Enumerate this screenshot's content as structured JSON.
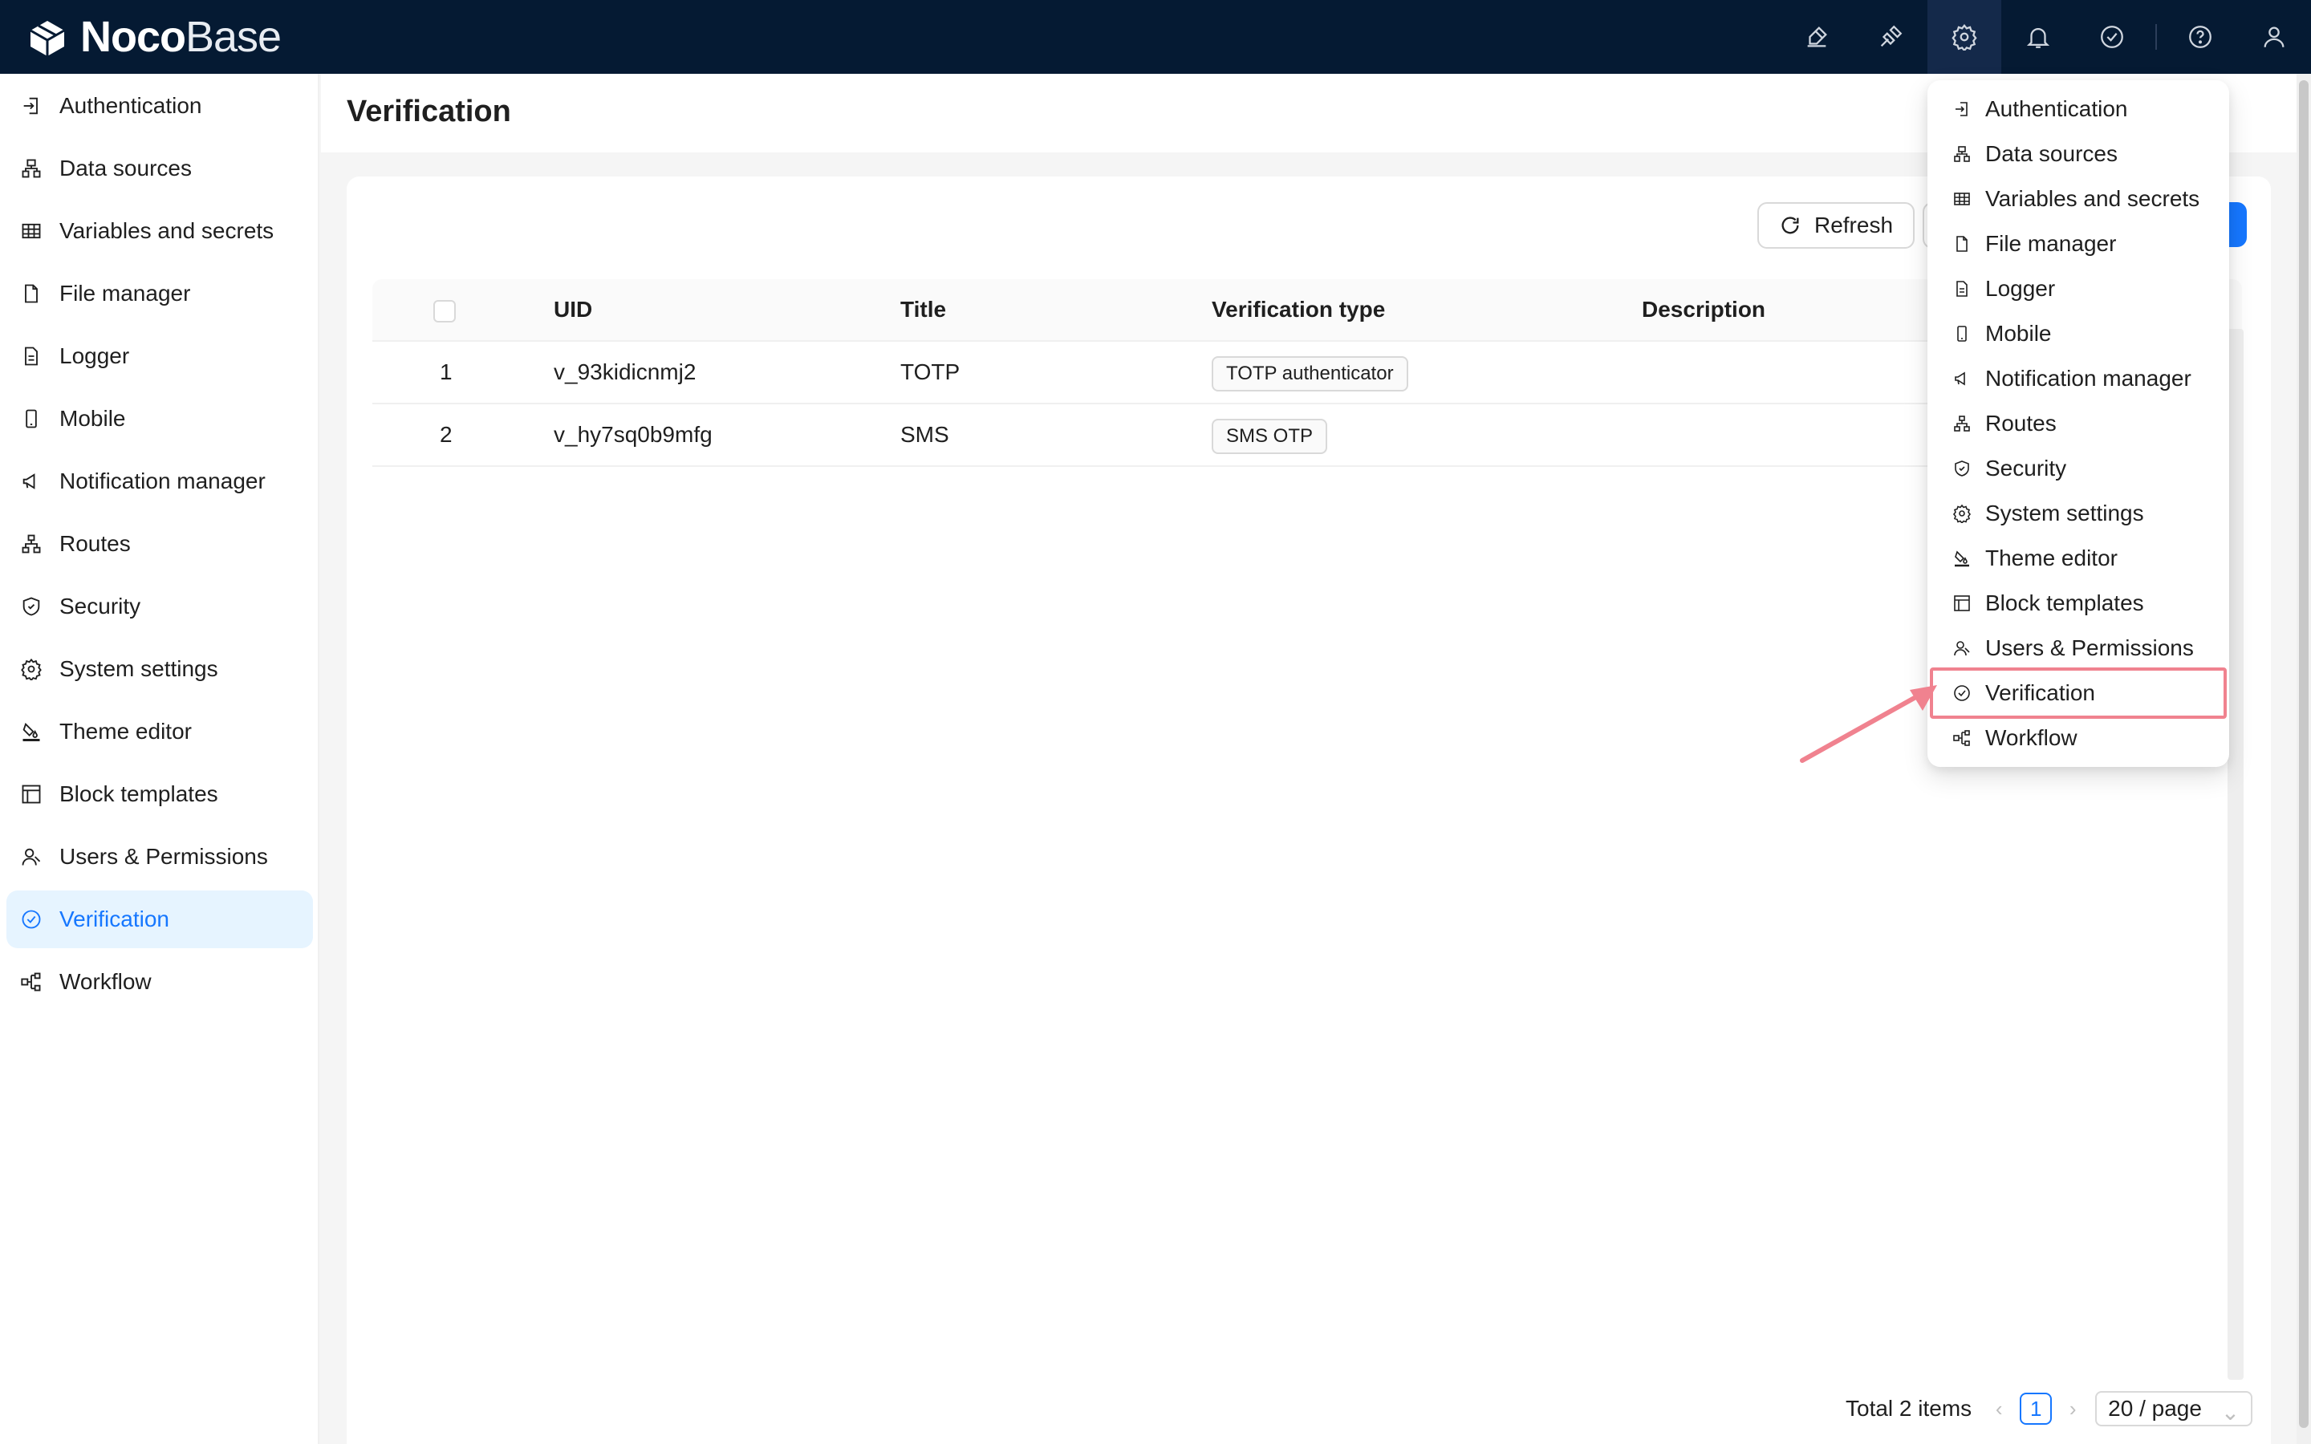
{
  "header": {
    "brand_bold": "Noco",
    "brand_light": "Base"
  },
  "sidebar": {
    "items": [
      {
        "label": "Authentication",
        "icon": "login-icon"
      },
      {
        "label": "Data sources",
        "icon": "database-icon"
      },
      {
        "label": "Variables and secrets",
        "icon": "table-icon"
      },
      {
        "label": "File manager",
        "icon": "file-icon"
      },
      {
        "label": "Logger",
        "icon": "file-text-icon"
      },
      {
        "label": "Mobile",
        "icon": "mobile-icon"
      },
      {
        "label": "Notification manager",
        "icon": "megaphone-icon"
      },
      {
        "label": "Routes",
        "icon": "sitemap-icon"
      },
      {
        "label": "Security",
        "icon": "shield-icon"
      },
      {
        "label": "System settings",
        "icon": "gear-icon"
      },
      {
        "label": "Theme editor",
        "icon": "bg-colors-icon"
      },
      {
        "label": "Block templates",
        "icon": "layout-icon"
      },
      {
        "label": "Users & Permissions",
        "icon": "users-icon"
      },
      {
        "label": "Verification",
        "icon": "check-circle-icon"
      },
      {
        "label": "Workflow",
        "icon": "workflow-icon"
      }
    ],
    "selected": "Verification"
  },
  "page": {
    "title": "Verification",
    "refresh_label": "Refresh"
  },
  "table": {
    "columns": [
      "UID",
      "Title",
      "Verification type",
      "Description"
    ],
    "rows": [
      {
        "index": "1",
        "uid": "v_93kidicnmj2",
        "title": "TOTP",
        "type": "TOTP authenticator",
        "description": ""
      },
      {
        "index": "2",
        "uid": "v_hy7sq0b9mfg",
        "title": "SMS",
        "type": "SMS OTP",
        "description": ""
      }
    ]
  },
  "pagination": {
    "total_text": "Total 2 items",
    "current_page": "1",
    "page_size": "20 / page"
  },
  "dropdown": {
    "items": [
      {
        "label": "Authentication"
      },
      {
        "label": "Data sources"
      },
      {
        "label": "Variables and secrets"
      },
      {
        "label": "File manager"
      },
      {
        "label": "Logger"
      },
      {
        "label": "Mobile"
      },
      {
        "label": "Notification manager"
      },
      {
        "label": "Routes"
      },
      {
        "label": "Security"
      },
      {
        "label": "System settings"
      },
      {
        "label": "Theme editor"
      },
      {
        "label": "Block templates"
      },
      {
        "label": "Users & Permissions"
      },
      {
        "label": "Verification"
      },
      {
        "label": "Workflow"
      }
    ],
    "highlighted": "Verification"
  },
  "colors": {
    "header_bg": "#051a33",
    "accent": "#1677ff",
    "highlight_box": "#f0828f"
  }
}
